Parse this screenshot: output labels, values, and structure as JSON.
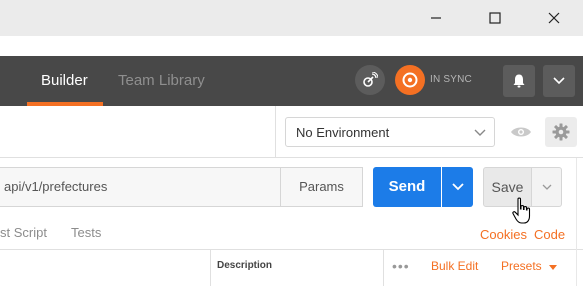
{
  "window": {
    "minimize_icon": "minimize-icon",
    "maximize_icon": "maximize-icon",
    "close_icon": "close-icon"
  },
  "header": {
    "tabs": [
      {
        "label": "Builder",
        "active": true
      },
      {
        "label": "Team Library",
        "active": false
      }
    ],
    "sync_status": "IN SYNC",
    "colors": {
      "accent": "#f47023",
      "header_bg": "#484848"
    }
  },
  "environment": {
    "selected": "No Environment"
  },
  "request": {
    "url": "api/v1/prefectures",
    "params_label": "Params",
    "send_label": "Send",
    "save_label": "Save",
    "send_color": "#1c7ce8"
  },
  "subtabs": {
    "pre_request": "st Script",
    "tests": "Tests",
    "cookies": "Cookies",
    "code": "Code"
  },
  "table": {
    "description_header": "Description",
    "more": "•••",
    "bulk_edit": "Bulk Edit",
    "presets": "Presets"
  }
}
